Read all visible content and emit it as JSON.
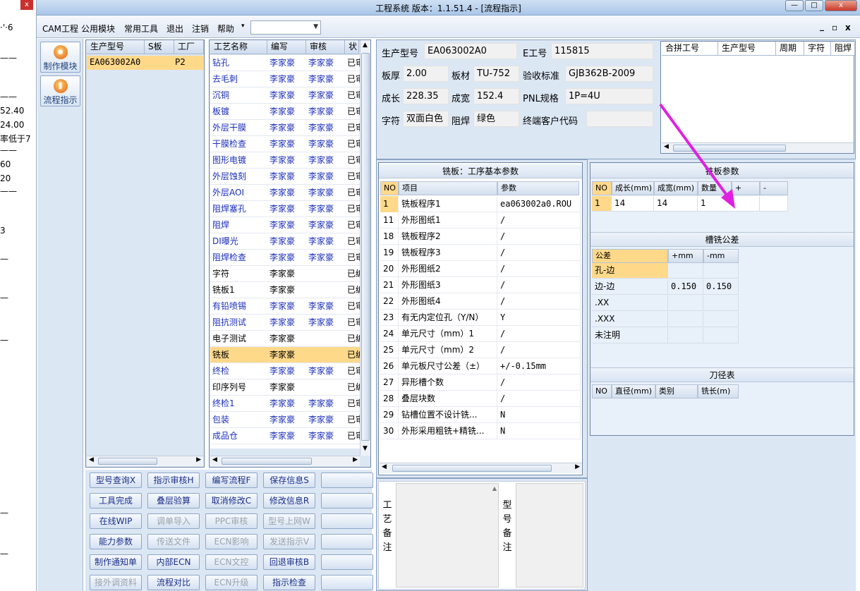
{
  "bg_window": {
    "lines": [
      "·'·6",
      "——",
      "——",
      "52.40",
      "24.00",
      "率低于7",
      "——",
      "60",
      "20",
      "——",
      "3",
      "—",
      "—",
      "—",
      "—",
      "—"
    ]
  },
  "titlebar": {
    "title": "工程系统   版本：1.1.51.4 - [流程指示]",
    "min": "—",
    "max": "□",
    "close": "x"
  },
  "menu": {
    "items": [
      "CAM工程",
      "公用模块",
      "常用工具",
      "退出",
      "注销",
      "帮助",
      "▾"
    ],
    "combo_value": "",
    "mdi_min": "_",
    "mdi_restore": "▫",
    "mdi_close": "x"
  },
  "leftnav": {
    "items": [
      {
        "label": "制作模块",
        "icon": "fire-icon"
      },
      {
        "label": "流程指示",
        "icon": "flow-icon"
      }
    ]
  },
  "model_grid": {
    "headers": [
      "生产型号",
      "S板",
      "工厂"
    ],
    "rows": [
      {
        "model": "EA063002A0",
        "s": "",
        "factory": "P2"
      }
    ]
  },
  "process_grid": {
    "headers": [
      "工艺名称",
      "编写",
      "审核",
      "状"
    ],
    "rows": [
      {
        "name": "钻孔",
        "writer": "李家豪",
        "auditor": "李家豪",
        "status": "已审"
      },
      {
        "name": "去毛刺",
        "writer": "李家豪",
        "auditor": "李家豪",
        "status": "已审"
      },
      {
        "name": "沉铜",
        "writer": "李家豪",
        "auditor": "李家豪",
        "status": "已审"
      },
      {
        "name": "板镀",
        "writer": "李家豪",
        "auditor": "李家豪",
        "status": "已审"
      },
      {
        "name": "外层干膜",
        "writer": "李家豪",
        "auditor": "李家豪",
        "status": "已审"
      },
      {
        "name": "干膜检查",
        "writer": "李家豪",
        "auditor": "李家豪",
        "status": "已审"
      },
      {
        "name": "图形电镀",
        "writer": "李家豪",
        "auditor": "李家豪",
        "status": "已审"
      },
      {
        "name": "外层蚀刻",
        "writer": "李家豪",
        "auditor": "李家豪",
        "status": "已审"
      },
      {
        "name": "外层AOI",
        "writer": "李家豪",
        "auditor": "李家豪",
        "status": "已审"
      },
      {
        "name": "阻焊塞孔",
        "writer": "李家豪",
        "auditor": "李家豪",
        "status": "已审"
      },
      {
        "name": "阻焊",
        "writer": "李家豪",
        "auditor": "李家豪",
        "status": "已审"
      },
      {
        "name": "DI曝光",
        "writer": "李家豪",
        "auditor": "李家豪",
        "status": "已审"
      },
      {
        "name": "阻焊检查",
        "writer": "李家豪",
        "auditor": "李家豪",
        "status": "已审"
      },
      {
        "name": "字符",
        "writer": "李家豪",
        "auditor": "",
        "status": "已编"
      },
      {
        "name": "铣板1",
        "writer": "李家豪",
        "auditor": "",
        "status": "已编"
      },
      {
        "name": "有铅喷锡",
        "writer": "李家豪",
        "auditor": "李家豪",
        "status": "已审"
      },
      {
        "name": "阻抗测试",
        "writer": "李家豪",
        "auditor": "李家豪",
        "status": "已审"
      },
      {
        "name": "电子测试",
        "writer": "李家豪",
        "auditor": "",
        "status": "已编"
      },
      {
        "name": "铣板",
        "writer": "李家豪",
        "auditor": "",
        "status": "已编"
      },
      {
        "name": "终检",
        "writer": "李家豪",
        "auditor": "李家豪",
        "status": "已审"
      },
      {
        "name": "印序列号",
        "writer": "李家豪",
        "auditor": "",
        "status": "已编"
      },
      {
        "name": "终检1",
        "writer": "李家豪",
        "auditor": "李家豪",
        "status": "已审"
      },
      {
        "name": "包装",
        "writer": "李家豪",
        "auditor": "李家豪",
        "status": "已审"
      },
      {
        "name": "成品仓",
        "writer": "李家豪",
        "auditor": "李家豪",
        "status": "已审"
      }
    ]
  },
  "buttons": [
    [
      "型号查询X",
      "指示审核H",
      "编写流程F",
      "保存信息S"
    ],
    [
      "工具完成",
      "叠层验算",
      "取消修改C",
      "修改信息R"
    ],
    [
      "在线WIP",
      "调单导入",
      "PPC审核",
      "型号上网W"
    ],
    [
      "能力参数",
      "传送文件",
      "ECN影响",
      "发送指示V"
    ],
    [
      "制作通知单",
      "内部ECN",
      "ECN文控",
      "回退审核B"
    ],
    [
      "接外调资料",
      "流程对比",
      "ECN升级",
      "指示检查"
    ]
  ],
  "info": {
    "model_label": "生产型号",
    "model": "EA063002A0",
    "eno_label": "E工号",
    "eno": "115815",
    "thick_label": "板厚",
    "thick": "2.00",
    "material_label": "板材",
    "material": "TU-752",
    "standard_label": "验收标准",
    "standard": "GJB362B-2009",
    "length_label": "成长",
    "length": "228.35",
    "width_label": "成宽",
    "width": "152.4",
    "pnl_label": "PNL规格",
    "pnl": "1P=4U",
    "char_label": "字符",
    "char": "双面白色",
    "mask_label": "阻焊",
    "mask": "绿色",
    "cust_label": "终端客户代码",
    "cust": ""
  },
  "merge_grid": {
    "headers": [
      "合拼工号",
      "生产型号",
      "周期",
      "字符",
      "阻焊"
    ]
  },
  "mill_params": {
    "title": "铣板：工序基本参数",
    "headers": [
      "NO",
      "项目",
      "参数"
    ],
    "rows": [
      {
        "no": "1",
        "item": "铣板程序1",
        "value": "ea063002a0.ROU"
      },
      {
        "no": "11",
        "item": "外形图纸1",
        "value": "/"
      },
      {
        "no": "18",
        "item": "铣板程序2",
        "value": "/"
      },
      {
        "no": "19",
        "item": "铣板程序3",
        "value": "/"
      },
      {
        "no": "20",
        "item": "外形图纸2",
        "value": "/"
      },
      {
        "no": "21",
        "item": "外形图纸3",
        "value": "/"
      },
      {
        "no": "22",
        "item": "外形图纸4",
        "value": "/"
      },
      {
        "no": "23",
        "item": "有无内定位孔（Y/N）",
        "value": "Y"
      },
      {
        "no": "24",
        "item": "单元尺寸（mm）1",
        "value": "/"
      },
      {
        "no": "25",
        "item": "单元尺寸（mm）2",
        "value": "/"
      },
      {
        "no": "26",
        "item": "单元板尺寸公差（±）",
        "value": "+/-0.15mm"
      },
      {
        "no": "27",
        "item": "异形槽个数",
        "value": "/"
      },
      {
        "no": "28",
        "item": "叠层块数",
        "value": "/"
      },
      {
        "no": "29",
        "item": "钻槽位置不设计铣...",
        "value": "N"
      },
      {
        "no": "30",
        "item": "外形采用粗铣+精铣...",
        "value": "N"
      }
    ]
  },
  "board_params": {
    "title": "铣板参数",
    "headers": [
      "NO",
      "成长(mm)",
      "成宽(mm)",
      "数量",
      "+",
      "-"
    ],
    "rows": [
      {
        "no": "1",
        "len": "14",
        "wid": "14",
        "qty": "1"
      }
    ]
  },
  "slot_tol": {
    "title": "槽铣公差",
    "headers": [
      "公差",
      "+mm",
      "-mm"
    ],
    "rows": [
      {
        "k": "孔-边",
        "p": "",
        "m": ""
      },
      {
        "k": "边-边",
        "p": "0.150",
        "m": "0.150"
      },
      {
        "k": ".XX",
        "p": "",
        "m": ""
      },
      {
        "k": ".XXX",
        "p": "",
        "m": ""
      },
      {
        "k": "未注明",
        "p": "",
        "m": ""
      }
    ]
  },
  "tool_table": {
    "title": "刀径表",
    "headers": [
      "NO",
      "直径(mm)",
      "类别",
      "铣长(m)"
    ]
  },
  "remarks": {
    "process_label": [
      "工",
      "艺",
      "备",
      "注"
    ],
    "model_label": [
      "型",
      "号",
      "备",
      "注"
    ]
  },
  "colors": {
    "accent_arrow": "#e020e0",
    "selected_row": "#ffd98a",
    "panel_bg": "#dce7f4"
  }
}
